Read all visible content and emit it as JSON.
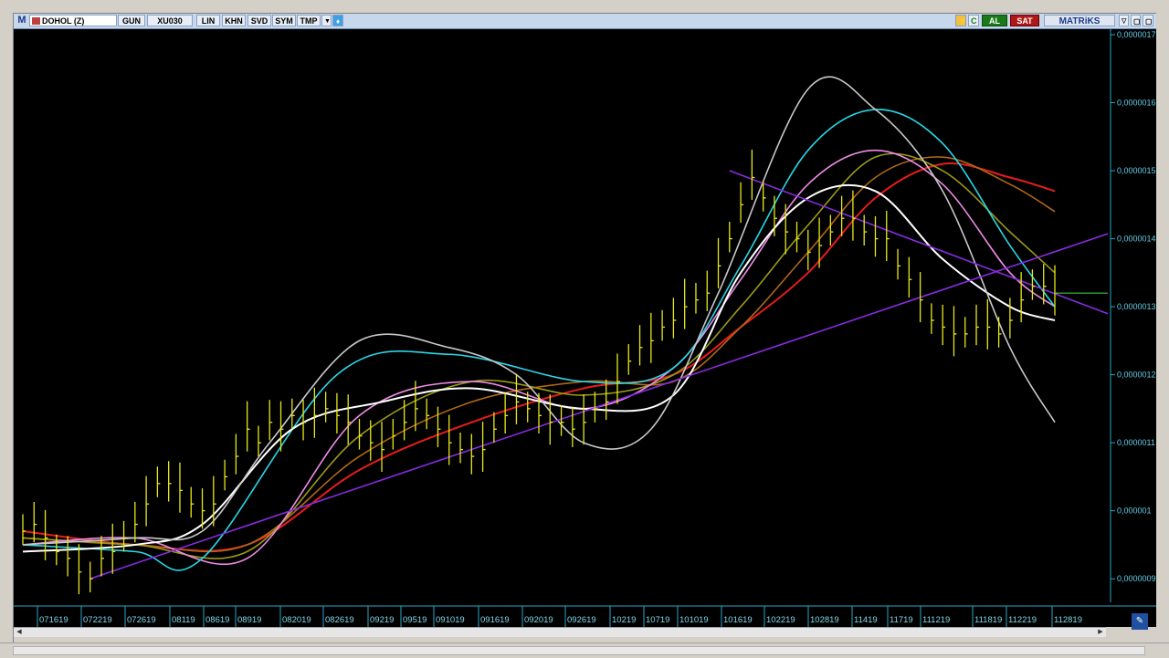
{
  "toolbar": {
    "menu_icon": "M",
    "symbol": "DOHOL (Z)",
    "period": "GUN",
    "index": "XU030",
    "buttons": [
      "LIN",
      "KHN",
      "SVD",
      "SYM",
      "TMP"
    ],
    "twitter_icon": "twitter-bird-icon",
    "buy_label": "AL",
    "sell_label": "SAT",
    "brand": "MATRiKS"
  },
  "colors": {
    "price_bars": "#e8e818",
    "trend_purple": "#8a2be2",
    "ma_red": "#e81c1c",
    "ma_cyan": "#28d8e8",
    "ma_pink": "#f08ce8",
    "ma_white": "#ffffff",
    "ma_gray": "#c8c8c8",
    "ma_olive": "#9a9a18",
    "ma_brown": "#b06818",
    "axis_text": "#5fd0e8"
  },
  "chart_data": {
    "type": "line",
    "x_ticks": [
      "071619",
      "072219",
      "072619",
      "08119",
      "08619",
      "08919",
      "082019",
      "082619",
      "09219",
      "09519",
      "091019",
      "091619",
      "092019",
      "092619",
      "10219",
      "10719",
      "101019",
      "101619",
      "102219",
      "102819",
      "11419",
      "11719",
      "111219",
      "111819",
      "112219",
      "112819"
    ],
    "y_ticks": [
      "0,0000017",
      "0,0000016",
      "0,0000015",
      "0,0000014",
      "0,0000013",
      "0,0000012",
      "0,0000011",
      "0,000001",
      "0,0000009"
    ],
    "ylim": [
      8.6e-07,
      1.7e-06
    ],
    "n": 93,
    "close": [
      9.7e-07,
      9.8e-07,
      9.6e-07,
      9.4e-07,
      9.3e-07,
      9.1e-07,
      9e-07,
      9.3e-07,
      9.4e-07,
      9.6e-07,
      9.8e-07,
      1.01e-06,
      1.04e-06,
      1.04e-06,
      1.03e-06,
      1.01e-06,
      1e-06,
      1.01e-06,
      1.05e-06,
      1.08e-06,
      1.12e-06,
      1.1e-06,
      1.13e-06,
      1.12e-06,
      1.14e-06,
      1.13e-06,
      1.14e-06,
      1.15e-06,
      1.14e-06,
      1.13e-06,
      1.11e-06,
      1.1e-06,
      1.09e-06,
      1.11e-06,
      1.13e-06,
      1.15e-06,
      1.14e-06,
      1.12e-06,
      1.1e-06,
      1.09e-06,
      1.08e-06,
      1.09e-06,
      1.12e-06,
      1.14e-06,
      1.16e-06,
      1.15e-06,
      1.14e-06,
      1.13e-06,
      1.13e-06,
      1.12e-06,
      1.13e-06,
      1.15e-06,
      1.16e-06,
      1.19e-06,
      1.22e-06,
      1.24e-06,
      1.25e-06,
      1.27e-06,
      1.28e-06,
      1.3e-06,
      1.31e-06,
      1.32e-06,
      1.36e-06,
      1.4e-06,
      1.45e-06,
      1.49e-06,
      1.46e-06,
      1.43e-06,
      1.41e-06,
      1.4e-06,
      1.38e-06,
      1.39e-06,
      1.41e-06,
      1.43e-06,
      1.43e-06,
      1.41e-06,
      1.4e-06,
      1.4e-06,
      1.36e-06,
      1.34e-06,
      1.31e-06,
      1.28e-06,
      1.27e-06,
      1.26e-06,
      1.26e-06,
      1.27e-06,
      1.27e-06,
      1.26e-06,
      1.28e-06,
      1.31e-06,
      1.33e-06,
      1.33e-06,
      1.32e-06
    ],
    "trend_lines": [
      {
        "name": "",
        "points": [
          [
            6,
            9e-07
          ],
          [
            92,
            1.38e-06
          ]
        ]
      },
      {
        "name": "",
        "points": [
          [
            63,
            1.5e-06
          ],
          [
            92,
            1.32e-06
          ]
        ]
      }
    ],
    "series": [
      {
        "color_key": "ma_red",
        "points": [
          [
            0,
            9.7e-07
          ],
          [
            10,
            9.5e-07
          ],
          [
            20,
            9.5e-07
          ],
          [
            30,
            1.06e-06
          ],
          [
            40,
            1.13e-06
          ],
          [
            50,
            1.18e-06
          ],
          [
            58,
            1.2e-06
          ],
          [
            64,
            1.27e-06
          ],
          [
            70,
            1.35e-06
          ],
          [
            76,
            1.46e-06
          ],
          [
            82,
            1.51e-06
          ],
          [
            88,
            1.49e-06
          ],
          [
            92,
            1.47e-06
          ]
        ]
      },
      {
        "color_key": "ma_brown",
        "points": [
          [
            0,
            9.6e-07
          ],
          [
            10,
            9.5e-07
          ],
          [
            20,
            9.5e-07
          ],
          [
            30,
            1.08e-06
          ],
          [
            40,
            1.16e-06
          ],
          [
            50,
            1.19e-06
          ],
          [
            58,
            1.19e-06
          ],
          [
            64,
            1.27e-06
          ],
          [
            70,
            1.38e-06
          ],
          [
            76,
            1.49e-06
          ],
          [
            82,
            1.52e-06
          ],
          [
            88,
            1.48e-06
          ],
          [
            92,
            1.44e-06
          ]
        ]
      },
      {
        "color_key": "ma_olive",
        "points": [
          [
            0,
            9.6e-07
          ],
          [
            10,
            9.5e-07
          ],
          [
            20,
            9.4e-07
          ],
          [
            30,
            1.11e-06
          ],
          [
            40,
            1.19e-06
          ],
          [
            50,
            1.17e-06
          ],
          [
            58,
            1.2e-06
          ],
          [
            64,
            1.3e-06
          ],
          [
            70,
            1.42e-06
          ],
          [
            76,
            1.52e-06
          ],
          [
            82,
            1.5e-06
          ],
          [
            88,
            1.41e-06
          ],
          [
            92,
            1.35e-06
          ]
        ]
      },
      {
        "color_key": "ma_pink",
        "points": [
          [
            0,
            9.5e-07
          ],
          [
            10,
            9.6e-07
          ],
          [
            20,
            9.3e-07
          ],
          [
            30,
            1.14e-06
          ],
          [
            40,
            1.19e-06
          ],
          [
            50,
            1.15e-06
          ],
          [
            58,
            1.21e-06
          ],
          [
            64,
            1.34e-06
          ],
          [
            70,
            1.48e-06
          ],
          [
            76,
            1.53e-06
          ],
          [
            82,
            1.48e-06
          ],
          [
            88,
            1.35e-06
          ],
          [
            92,
            1.3e-06
          ]
        ]
      },
      {
        "color_key": "ma_cyan",
        "points": [
          [
            0,
            9.5e-07
          ],
          [
            10,
            9.4e-07
          ],
          [
            16,
            9.3e-07
          ],
          [
            28,
            1.2e-06
          ],
          [
            38,
            1.23e-06
          ],
          [
            50,
            1.19e-06
          ],
          [
            58,
            1.21e-06
          ],
          [
            64,
            1.36e-06
          ],
          [
            70,
            1.53e-06
          ],
          [
            76,
            1.59e-06
          ],
          [
            82,
            1.54e-06
          ],
          [
            88,
            1.39e-06
          ],
          [
            92,
            1.3e-06
          ]
        ]
      },
      {
        "color_key": "ma_white",
        "points": [
          [
            0,
            9.4e-07
          ],
          [
            10,
            9.5e-07
          ],
          [
            16,
            9.8e-07
          ],
          [
            24,
            1.12e-06
          ],
          [
            32,
            1.16e-06
          ],
          [
            40,
            1.18e-06
          ],
          [
            50,
            1.15e-06
          ],
          [
            58,
            1.17e-06
          ],
          [
            64,
            1.35e-06
          ],
          [
            70,
            1.46e-06
          ],
          [
            76,
            1.47e-06
          ],
          [
            82,
            1.37e-06
          ],
          [
            88,
            1.3e-06
          ],
          [
            92,
            1.28e-06
          ]
        ]
      },
      {
        "color_key": "ma_gray",
        "points": [
          [
            0,
            9.5e-07
          ],
          [
            10,
            9.6e-07
          ],
          [
            16,
            9.7e-07
          ],
          [
            22,
            1.1e-06
          ],
          [
            30,
            1.25e-06
          ],
          [
            38,
            1.24e-06
          ],
          [
            44,
            1.2e-06
          ],
          [
            50,
            1.1e-06
          ],
          [
            56,
            1.12e-06
          ],
          [
            62,
            1.32e-06
          ],
          [
            70,
            1.62e-06
          ],
          [
            76,
            1.59e-06
          ],
          [
            82,
            1.47e-06
          ],
          [
            88,
            1.24e-06
          ],
          [
            92,
            1.13e-06
          ]
        ]
      }
    ]
  }
}
